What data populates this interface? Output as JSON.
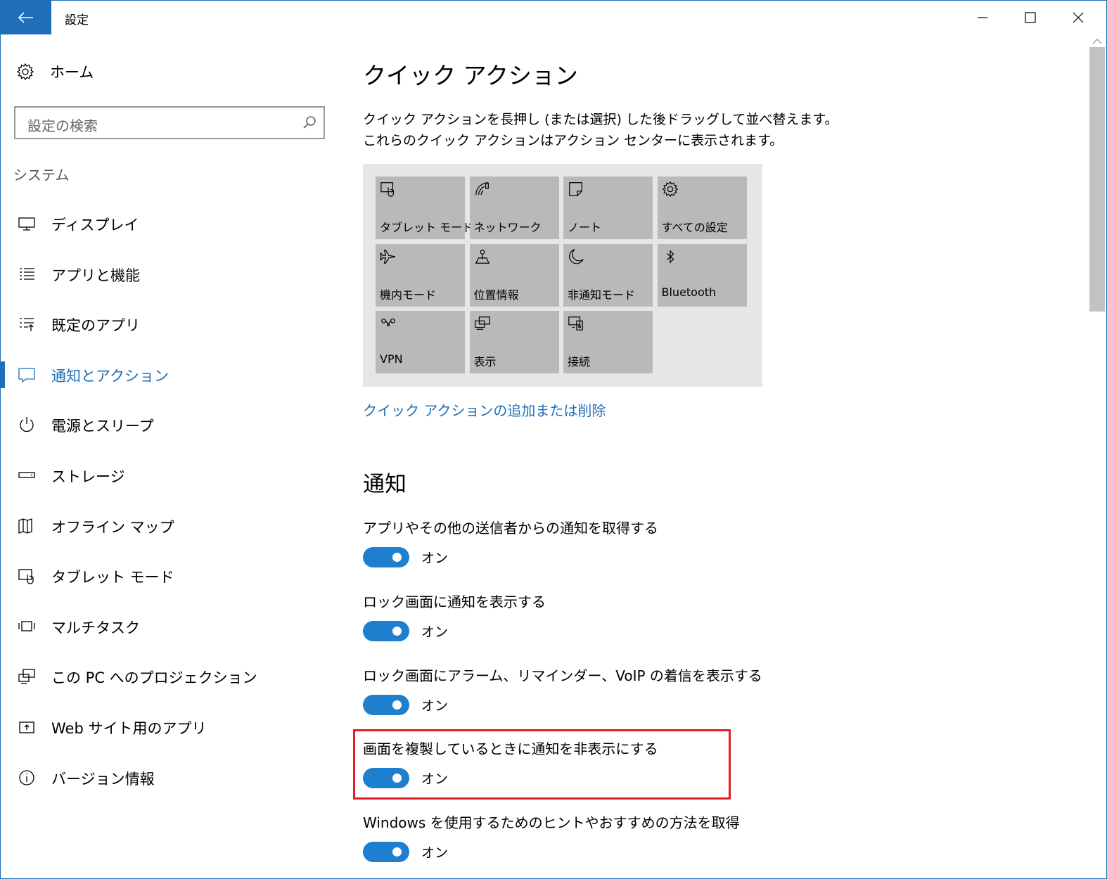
{
  "window": {
    "title": "設定",
    "accent": "#1e6fb8"
  },
  "sidebar": {
    "home_label": "ホーム",
    "search_placeholder": "設定の検索",
    "section_title": "システム",
    "items": [
      {
        "label": "ディスプレイ",
        "icon": "monitor-icon",
        "active": false
      },
      {
        "label": "アプリと機能",
        "icon": "list-icon",
        "active": false
      },
      {
        "label": "既定のアプリ",
        "icon": "default-apps-icon",
        "active": false
      },
      {
        "label": "通知とアクション",
        "icon": "notification-icon",
        "active": true
      },
      {
        "label": "電源とスリープ",
        "icon": "power-icon",
        "active": false
      },
      {
        "label": "ストレージ",
        "icon": "storage-icon",
        "active": false
      },
      {
        "label": "オフライン マップ",
        "icon": "map-icon",
        "active": false
      },
      {
        "label": "タブレット モード",
        "icon": "tablet-icon",
        "active": false
      },
      {
        "label": "マルチタスク",
        "icon": "multitask-icon",
        "active": false
      },
      {
        "label": "この PC へのプロジェクション",
        "icon": "projection-icon",
        "active": false
      },
      {
        "label": "Web サイト用のアプリ",
        "icon": "web-apps-icon",
        "active": false
      },
      {
        "label": "バージョン情報",
        "icon": "info-icon",
        "active": false
      }
    ]
  },
  "main": {
    "title": "クイック アクション",
    "description": "クイック アクションを長押し (または選択) した後ドラッグして並べ替えます。これらのクイック アクションはアクション センターに表示されます。",
    "quick_actions": [
      {
        "label": "タブレット モード",
        "icon": "tablet-mode-icon"
      },
      {
        "label": "ネットワーク",
        "icon": "network-icon"
      },
      {
        "label": "ノート",
        "icon": "note-icon"
      },
      {
        "label": "すべての設定",
        "icon": "gear-icon"
      },
      {
        "label": "機内モード",
        "icon": "airplane-icon"
      },
      {
        "label": "位置情報",
        "icon": "location-icon"
      },
      {
        "label": "非通知モード",
        "icon": "moon-icon"
      },
      {
        "label": "Bluetooth",
        "icon": "bluetooth-icon"
      },
      {
        "label": "VPN",
        "icon": "vpn-icon"
      },
      {
        "label": "表示",
        "icon": "display-icon"
      },
      {
        "label": "接続",
        "icon": "connect-icon"
      }
    ],
    "add_remove_link": "クイック アクションの追加または削除",
    "notifications_title": "通知",
    "settings": [
      {
        "label": "アプリやその他の送信者からの通知を取得する",
        "state": "オン",
        "on": true
      },
      {
        "label": "ロック画面に通知を表示する",
        "state": "オン",
        "on": true
      },
      {
        "label": "ロック画面にアラーム、リマインダー、VoIP の着信を表示する",
        "state": "オン",
        "on": true
      },
      {
        "label": "画面を複製しているときに通知を非表示にする",
        "state": "オン",
        "on": true
      },
      {
        "label": "Windows を使用するためのヒントやおすすめの方法を取得",
        "state": "オン",
        "on": true
      }
    ],
    "highlight_color": "#e21e24"
  }
}
